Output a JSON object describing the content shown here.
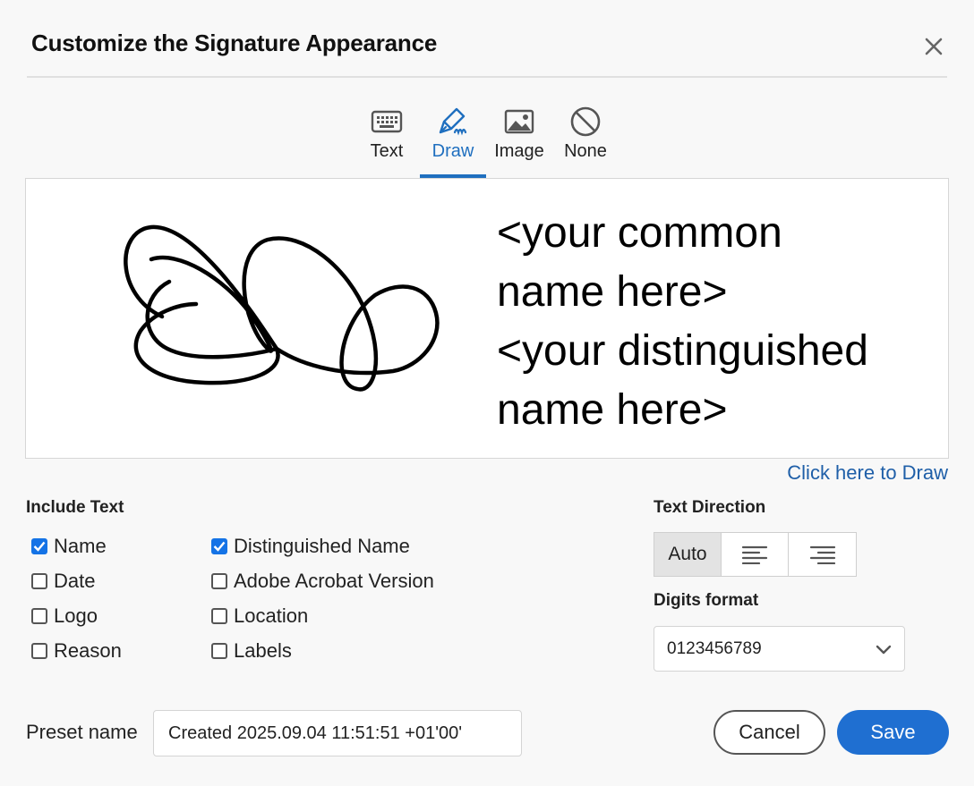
{
  "dialog": {
    "title": "Customize the Signature Appearance"
  },
  "tabs": [
    {
      "label": "Text",
      "icon": "keyboard-icon"
    },
    {
      "label": "Draw",
      "icon": "pen-icon",
      "active": true
    },
    {
      "label": "Image",
      "icon": "image-icon"
    },
    {
      "label": "None",
      "icon": "none-icon"
    }
  ],
  "preview": {
    "lines": [
      "<your common",
      "name here>",
      "<your distinguished",
      "name here>"
    ]
  },
  "draw_link": "Click here to Draw",
  "include_text": {
    "label": "Include Text",
    "options": [
      {
        "label": "Name",
        "checked": true
      },
      {
        "label": "Distinguished Name",
        "checked": true
      },
      {
        "label": "Date",
        "checked": false
      },
      {
        "label": "Adobe Acrobat Version",
        "checked": false
      },
      {
        "label": "Logo",
        "checked": false
      },
      {
        "label": "Location",
        "checked": false
      },
      {
        "label": "Reason",
        "checked": false
      },
      {
        "label": "Labels",
        "checked": false
      }
    ]
  },
  "text_direction": {
    "label": "Text Direction",
    "options": [
      {
        "label": "Auto",
        "active": true
      },
      {
        "icon": "align-left-icon"
      },
      {
        "icon": "align-right-icon"
      }
    ]
  },
  "digits_format": {
    "label": "Digits format",
    "value": "0123456789"
  },
  "preset": {
    "label": "Preset name",
    "value": "Created 2025.09.04 11:51:51 +01'00'"
  },
  "buttons": {
    "cancel": "Cancel",
    "save": "Save"
  },
  "colors": {
    "accent": "#1f6fbf",
    "save": "#1f6fd1",
    "checkbox": "#1473e6"
  }
}
